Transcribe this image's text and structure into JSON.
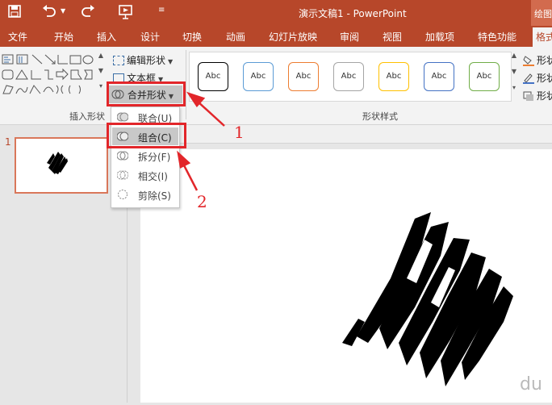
{
  "window": {
    "title": "演示文稿1 - PowerPoint",
    "context_tab_label": "绘图工具"
  },
  "quick_access": {
    "icons": [
      "save-icon",
      "undo-icon",
      "redo-icon",
      "start-from-beginning-icon",
      "customize-qat-icon"
    ]
  },
  "tabs": [
    {
      "label": "文件"
    },
    {
      "label": "开始"
    },
    {
      "label": "插入"
    },
    {
      "label": "设计"
    },
    {
      "label": "切换"
    },
    {
      "label": "动画"
    },
    {
      "label": "幻灯片放映"
    },
    {
      "label": "审阅"
    },
    {
      "label": "视图"
    },
    {
      "label": "加载项"
    },
    {
      "label": "特色功能"
    },
    {
      "label": "格式",
      "active": true
    }
  ],
  "ribbon": {
    "insert_shapes": {
      "group_label": "插入形状",
      "edit_shape_label": "编辑形状",
      "text_box_label": "文本框",
      "merge_shapes_label": "合并形状"
    },
    "shape_styles": {
      "group_label": "形状样式",
      "presets": [
        {
          "label": "Abc",
          "color": "#000000"
        },
        {
          "label": "Abc",
          "color": "#5b9bd5"
        },
        {
          "label": "Abc",
          "color": "#ed7d31"
        },
        {
          "label": "Abc",
          "color": "#a5a5a5"
        },
        {
          "label": "Abc",
          "color": "#ffc000"
        },
        {
          "label": "Abc",
          "color": "#4472c4"
        },
        {
          "label": "Abc",
          "color": "#70ad47"
        }
      ],
      "right_commands": [
        {
          "label": "形状"
        },
        {
          "label": "形状"
        },
        {
          "label": "形状"
        }
      ]
    }
  },
  "merge_menu": {
    "items": [
      {
        "label": "联合(U)",
        "icon": "union-icon"
      },
      {
        "label": "组合(C)",
        "icon": "combine-icon",
        "highlighted": true
      },
      {
        "label": "拆分(F)",
        "icon": "fragment-icon"
      },
      {
        "label": "相交(I)",
        "icon": "intersect-icon"
      },
      {
        "label": "剪除(S)",
        "icon": "subtract-icon"
      }
    ]
  },
  "slides_panel": {
    "slide_number": "1"
  },
  "annotations": {
    "callout_1": "1",
    "callout_2": "2",
    "color": "#e2262a"
  },
  "watermark": {
    "text": "du"
  },
  "colors": {
    "accent": "#b7472a",
    "ribbon_bg": "#f3f3f3",
    "highlight": "#c8c8c8"
  }
}
